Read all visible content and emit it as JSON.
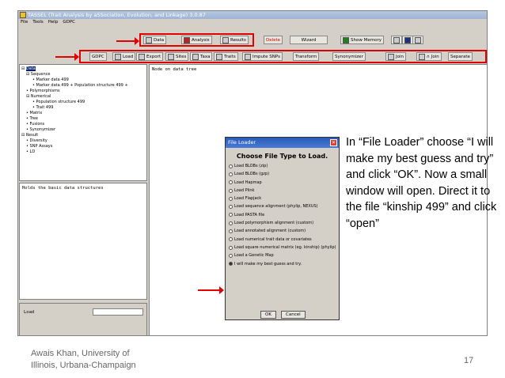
{
  "app": {
    "title": "TASSEL (Trait Analysis by aSSociation, Evolution, and Linkage) 3.0.87",
    "menu": [
      "File",
      "Tools",
      "Help",
      "GDPC"
    ]
  },
  "toolbar1": {
    "data": "Data",
    "analysis": "Analysis",
    "results": "Results",
    "delete": "Delete",
    "wizard": "Wizard",
    "memory": "Show Memory"
  },
  "toolbar2": {
    "gdpc": "GDPC",
    "load": "Load",
    "export": "Export",
    "sites": "Sites",
    "taxa": "Taxa",
    "traits": "Traits",
    "impute": "Impute SNPs",
    "transform": "Transform",
    "synonymizer": "Synonymizer",
    "join": "Join",
    "ojoin": "∩ Join",
    "separate": "Separate"
  },
  "tree": [
    "Data",
    "Sequence",
    "Marker data 499",
    "Marker data 499 + Population structure 499 +",
    "Polymorphisms",
    "Numerical",
    "Population structure 499",
    "Trait 499",
    "Matrix",
    "Tree",
    "Fusions",
    "Synonymizer",
    "Result",
    "Diversity",
    "SNP Assays",
    "LD"
  ],
  "panels": {
    "node_text": "Node on data tree",
    "desc_text": "Holds the basic data structures",
    "load_label": "Load"
  },
  "dialog": {
    "title": "File Loader",
    "heading": "Choose File Type to Load.",
    "options": [
      "Load BLOBs (zip)",
      "Load BLOBs (gzp)",
      "Load Hapmap",
      "Load Plink",
      "Load Flapjack",
      "Load sequence alignment (phylip, NEXUS)",
      "Load PASTA file",
      "Load polymorphism alignment (custom)",
      "Load annotated alignment (custom)",
      "Load numerical trait data or covariates",
      "Load square numerical matrix (eg. kinship) (phylip)",
      "Load a Genetic Map",
      "I will make my best guess and try."
    ],
    "ok": "OK",
    "cancel": "Cancel"
  },
  "caption": "In “File Loader” choose “I will make my best guess and try” and click “OK”. Now a small window will open. Direct it to the file “kinship 499” and click “open”",
  "footer": {
    "line1": "Awais Khan, University of",
    "line2": "Illinois, Urbana-Champaign",
    "page": "17"
  }
}
